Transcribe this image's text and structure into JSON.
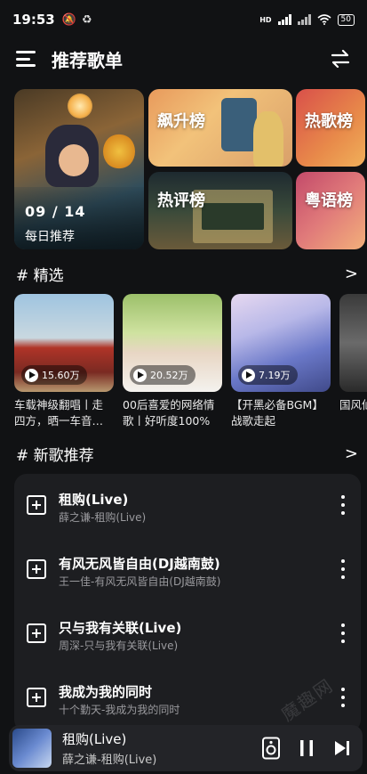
{
  "status_bar": {
    "time": "19:53",
    "network_label": "HD",
    "battery": "50"
  },
  "header": {
    "title": "推荐歌单"
  },
  "banners": {
    "daily": {
      "date": "09 / 14",
      "label": "每日推荐"
    },
    "soar": {
      "label": "飙升榜"
    },
    "hot": {
      "label": "热歌榜"
    },
    "comment": {
      "label": "热评榜"
    },
    "cantonese": {
      "label": "粤语榜"
    }
  },
  "featured": {
    "title": "# 精选",
    "arrow": ">",
    "playlists": [
      {
        "count": "15.60万",
        "title": "车载神级翻唱丨走四方，晒一车音…"
      },
      {
        "count": "20.52万",
        "title": "00后喜爱的网络情歌丨好听度100%"
      },
      {
        "count": "7.19万",
        "title": "【开黑必备BGM】战歌走起"
      },
      {
        "count": "",
        "title": "国风仙毕，此"
      }
    ]
  },
  "new_songs": {
    "title": "# 新歌推荐",
    "arrow": ">",
    "songs": [
      {
        "title": "租购(Live)",
        "subtitle": "薛之谦-租购(Live)"
      },
      {
        "title": "有风无风皆自由(DJ越南鼓)",
        "subtitle": "王一佳-有风无风皆自由(DJ越南鼓)"
      },
      {
        "title": "只与我有关联(Live)",
        "subtitle": "周深-只与我有关联(Live)"
      },
      {
        "title": "我成为我的同时",
        "subtitle": "十个勤天-我成为我的同时"
      }
    ]
  },
  "watermark": "魔趣网",
  "player": {
    "title": "租购(Live)",
    "subtitle": "薛之谦-租购(Live)"
  }
}
